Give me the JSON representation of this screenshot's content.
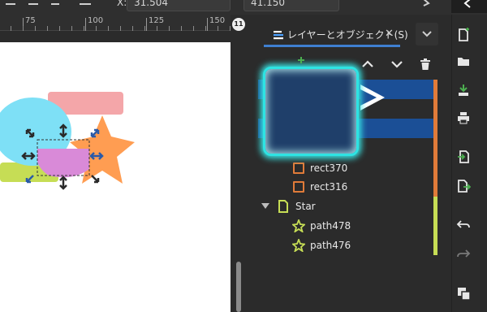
{
  "toolbar": {
    "x_label": "X:",
    "x_value": "31.504",
    "y_value": "41.150"
  },
  "ruler": {
    "labels": [
      "75",
      "100",
      "125",
      "150"
    ]
  },
  "snap_badge": "11",
  "layers_panel": {
    "tab_title": "レイヤーとオブジェクト(S)",
    "close_glyph": "✕",
    "items": [
      {
        "label": "rect370",
        "type": "rect"
      },
      {
        "label": "rect316",
        "type": "rect"
      },
      {
        "label": "Star",
        "type": "group"
      },
      {
        "label": "path478",
        "type": "star"
      },
      {
        "label": "path476",
        "type": "star"
      }
    ]
  },
  "colors": {
    "accent": "#3f7fd1",
    "selection_row": "#1b4f96",
    "highlight_glow": "#2ee3e3",
    "orange_layer": "#e07b39",
    "green_layer": "#c6dd55",
    "star_fill": "#ff9d52",
    "ellipse_fill": "#7ee0f6",
    "pink_rect": "#f4a6a9",
    "purple_overlap": "#d98ad8"
  }
}
